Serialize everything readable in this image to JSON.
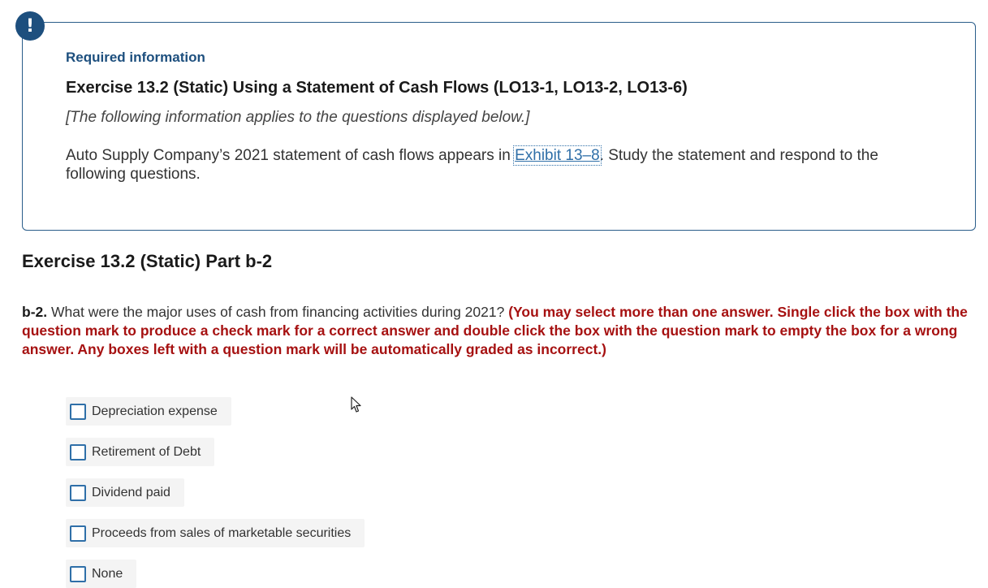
{
  "info": {
    "badge_icon": "!",
    "required_label": "Required information",
    "title": "Exercise 13.2 (Static) Using a Statement of Cash Flows (LO13-1, LO13-2, LO13-6)",
    "applies_text": "[The following information applies to the questions displayed below.]",
    "desc_before": "Auto Supply Company’s 2021 statement of cash flows appears in ",
    "exhibit_link": "Exhibit 13–8",
    "desc_after": ". Study the statement and respond to the following questions."
  },
  "part": {
    "title": "Exercise 13.2 (Static) Part b-2"
  },
  "question": {
    "number": "b-2.",
    "text": " What were the major uses of cash from financing activities during 2021? ",
    "instructions": "(You may select more than one answer. Single click the box with the question mark to produce a check mark for a correct answer and double click the box with the question mark to empty the box for a wrong answer. Any boxes left with a question mark will be automatically graded as incorrect.)"
  },
  "options": [
    {
      "label": "Depreciation expense",
      "checked": false
    },
    {
      "label": "Retirement of Debt",
      "checked": false
    },
    {
      "label": "Dividend paid",
      "checked": false
    },
    {
      "label": "Proceeds from sales of marketable securities",
      "checked": false
    },
    {
      "label": "None",
      "checked": false
    }
  ],
  "colors": {
    "accent": "#1d4f7e",
    "link": "#2f6fa8",
    "instruction": "#a61111"
  }
}
